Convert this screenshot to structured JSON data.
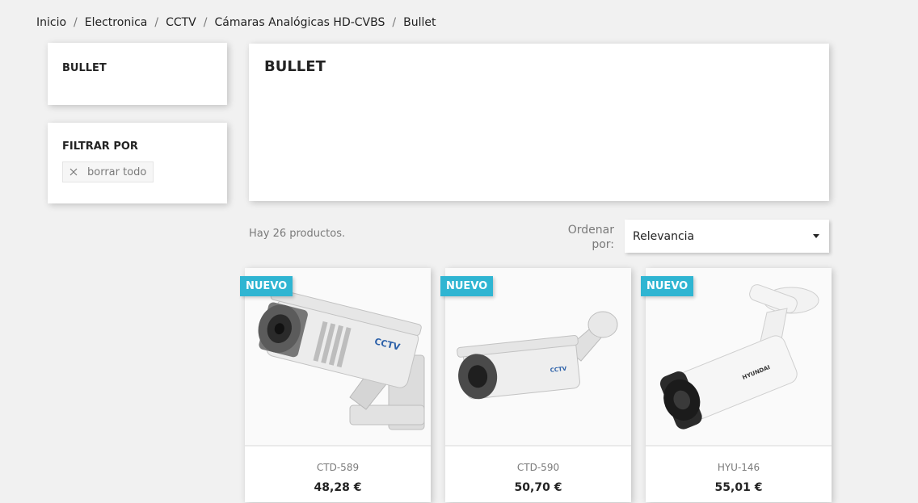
{
  "breadcrumb": {
    "items": [
      {
        "label": "Inicio"
      },
      {
        "label": "Electronica"
      },
      {
        "label": "CCTV"
      },
      {
        "label": "Cámaras Analógicas HD-CVBS"
      },
      {
        "label": "Bullet"
      }
    ],
    "separator": "/"
  },
  "sidebar": {
    "category_title": "BULLET",
    "filter": {
      "title": "FILTRAR POR",
      "clear_label": "borrar todo",
      "clear_icon": "close-icon"
    }
  },
  "category": {
    "title": "BULLET"
  },
  "products_toolbar": {
    "count_text": "Hay 26 productos.",
    "sort_label": "Ordenar por:",
    "sort_value": "Relevancia",
    "sort_icon": "caret-down-icon"
  },
  "products": [
    {
      "badge": "NUEVO",
      "name": "CTD-589",
      "price": "48,28 €",
      "image": "bullet-camera-icon"
    },
    {
      "badge": "NUEVO",
      "name": "CTD-590",
      "price": "50,70 €",
      "image": "bullet-camera-icon"
    },
    {
      "badge": "NUEVO",
      "name": "HYU-146",
      "price": "55,01 €",
      "image": "bullet-camera-icon"
    }
  ],
  "colors": {
    "accent": "#2fb5d2",
    "background": "#f1f1f1",
    "text": "#232323",
    "muted": "#7a7a7a"
  }
}
